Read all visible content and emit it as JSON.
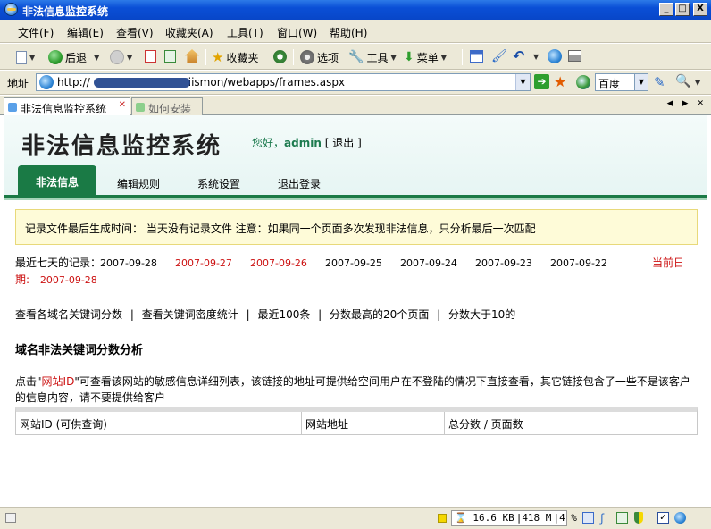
{
  "window": {
    "title": "非法信息监控系统",
    "buttons": {
      "minimize": "_",
      "maximize": "□",
      "close": "X"
    }
  },
  "menu": {
    "items": [
      "文件(F)",
      "编辑(E)",
      "查看(V)",
      "收藏夹(A)",
      "工具(T)",
      "窗口(W)",
      "帮助(H)"
    ]
  },
  "toolbar": {
    "back": "后退",
    "favorites": "收藏夹",
    "options": "选项",
    "tools": "工具",
    "menu": "菜单"
  },
  "address": {
    "label": "地址",
    "url_prefix": "http://",
    "url_suffix": "iismon/webapps/frames.aspx",
    "search_engine": "百度"
  },
  "tabs": [
    {
      "label": "非法信息监控系统"
    },
    {
      "label": "如何安装"
    }
  ],
  "header": {
    "site_title": "非法信息监控系统",
    "greeting": "您好，",
    "username": "admin",
    "logout_open": "[",
    "logout_label": "退出",
    "logout_close": "]"
  },
  "nav": {
    "items": [
      "非法信息",
      "编辑规则",
      "系统设置",
      "退出登录"
    ]
  },
  "notice": {
    "text": "记录文件最后生成时间： 当天没有记录文件 注意：如果同一个页面多次发现非法信息，只分析最后一次匹配"
  },
  "recent": {
    "label": "最近七天的记录：",
    "dates": [
      {
        "date": "2007-09-28",
        "highlight": false
      },
      {
        "date": "2007-09-27",
        "highlight": true
      },
      {
        "date": "2007-09-26",
        "highlight": true
      },
      {
        "date": "2007-09-25",
        "highlight": false
      },
      {
        "date": "2007-09-24",
        "highlight": false
      },
      {
        "date": "2007-09-23",
        "highlight": false
      },
      {
        "date": "2007-09-22",
        "highlight": false
      }
    ],
    "current_label_a": "当前日",
    "current_label_b": "期:",
    "current_date": "2007-09-28"
  },
  "links": {
    "items": [
      "查看各域名关键词分数",
      "查看关键词密度统计",
      "最近100条",
      "分数最高的20个页面",
      "分数大于10的"
    ],
    "separator": "|"
  },
  "section": {
    "title": "域名非法关键词分数分析",
    "desc_prefix": "点击\"",
    "desc_link": "网站ID",
    "desc_suffix": "\"可查看该网站的敏感信息详细列表，该链接的地址可提供给空间用户在不登陆的情况下直接查看，其它链接包含了一些不是该客户的信息内容，请不要提供给客户"
  },
  "table": {
    "headers": [
      "网站ID (可供查询)",
      "网站地址",
      "总分数 / 页面数"
    ]
  },
  "status": {
    "mem_a": "16.6 KB",
    "mem_b": "418 M",
    "cpu": "4 %"
  },
  "colors": {
    "title_bar": "#0a4fd6",
    "nav_green": "#1a7a45",
    "notice_bg": "#fefbd8",
    "highlight_red": "#cc1111"
  }
}
